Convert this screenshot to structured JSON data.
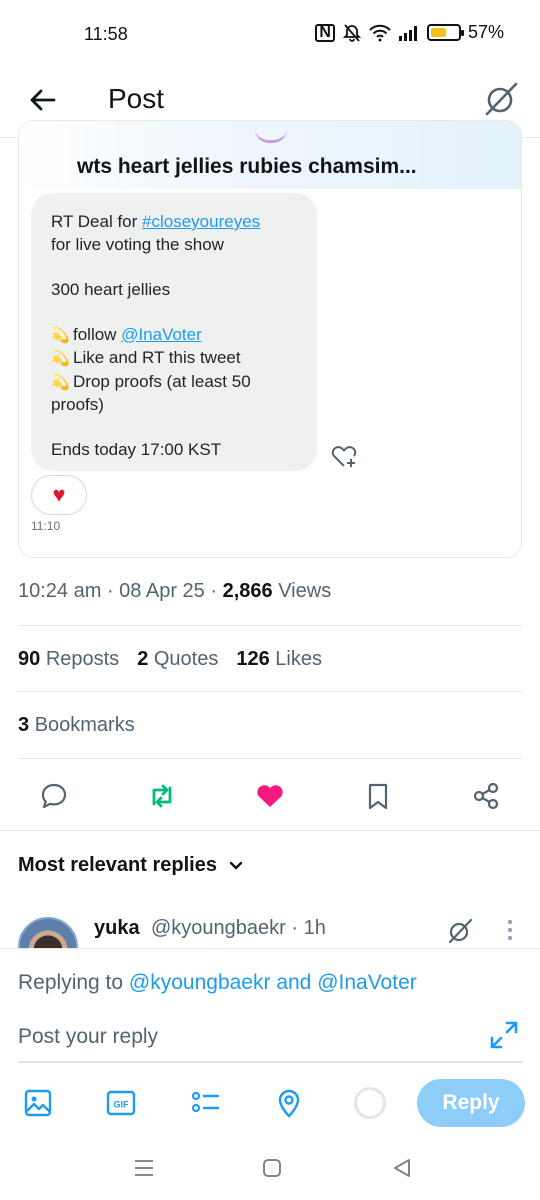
{
  "status_bar": {
    "time": "11:58",
    "nfc": "N",
    "battery_percent": "57%",
    "battery_level": 0.57,
    "battery_color": "#f4c21a"
  },
  "header": {
    "title": "Post",
    "back_icon": "arrow-left-icon",
    "right_icon": "grok-icon"
  },
  "embedded": {
    "title": "wts heart jellies rubies chamsim...",
    "message": {
      "lines": [
        {
          "pre": "RT Deal for ",
          "link": "#closeyoureyes"
        },
        {
          "text": "for live voting the show"
        },
        {
          "text": "300 heart jellies"
        },
        {
          "pre": "follow ",
          "link": "@InaVoter"
        },
        {
          "text": "Like and RT this tweet"
        },
        {
          "text": "Drop proofs (at least 50"
        },
        {
          "text": "proofs)"
        },
        {
          "text": "Ends today 17:00 KST"
        }
      ],
      "emoji": "💫"
    },
    "reaction": "♥",
    "time": "11:10"
  },
  "post_meta": {
    "time": "10:24 am",
    "date": "08 Apr 25",
    "views_count": "2,866",
    "views_label": "Views"
  },
  "stats": {
    "reposts_count": "90",
    "reposts_label": "Reposts",
    "quotes_count": "2",
    "quotes_label": "Quotes",
    "likes_count": "126",
    "likes_label": "Likes",
    "bookmarks_count": "3",
    "bookmarks_label": "Bookmarks"
  },
  "colors": {
    "accent": "#1d9bf0",
    "repost": "#00ba7c",
    "like": "#f91880",
    "muted": "#536471"
  },
  "replies_section": {
    "sort_label": "Most relevant replies",
    "first_reply": {
      "name": "yuka",
      "handle": "@kyoungbaekr · 1h"
    }
  },
  "composer": {
    "replying_prefix": "Replying to ",
    "mention_1": "@kyoungbaekr",
    "conjunction": " and ",
    "mention_2": "@InaVoter",
    "placeholder": "Post your reply",
    "reply_button": "Reply"
  },
  "toolbar_icons": [
    "image-icon",
    "gif-icon",
    "poll-icon",
    "location-icon"
  ]
}
